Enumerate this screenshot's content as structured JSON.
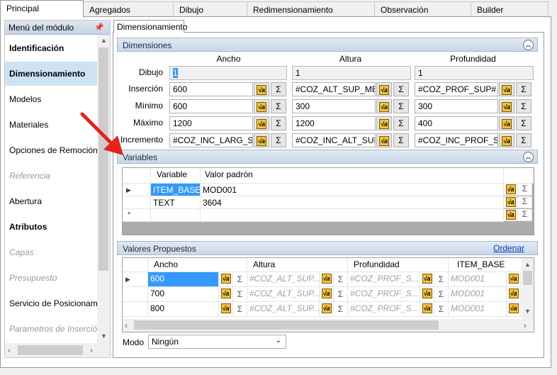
{
  "top_tabs": [
    "Principal",
    "Agregados",
    "Dibujo",
    "Redimensionamiento",
    "Observación",
    "Builder"
  ],
  "sidebar": {
    "title": "Menú del módulo",
    "pin_icon": "pin-icon",
    "items": [
      {
        "label": "Identificación",
        "style": "bold"
      },
      {
        "label": "Dimensionamiento",
        "style": "bold-selected"
      },
      {
        "label": "Modelos",
        "style": "normal"
      },
      {
        "label": "Materiales",
        "style": "normal"
      },
      {
        "label": "Opciones de Remoción",
        "style": "normal"
      },
      {
        "label": "Referencia",
        "style": "disabled"
      },
      {
        "label": "Abertura",
        "style": "normal"
      },
      {
        "label": "Atributos",
        "style": "bold"
      },
      {
        "label": "Capas",
        "style": "disabled"
      },
      {
        "label": "Presupuesto",
        "style": "disabled"
      },
      {
        "label": "Servicio de Posicionamiento",
        "style": "normal"
      },
      {
        "label": "Parametros de Inserción",
        "style": "disabled"
      }
    ]
  },
  "subtab": "Dimensionamiento",
  "dimensiones": {
    "title": "Dimensiones",
    "columns": [
      "Ancho",
      "Altura",
      "Profundidad"
    ],
    "rows": [
      {
        "label": "Dibujo",
        "values": [
          "1",
          "1",
          "1"
        ]
      },
      {
        "label": "Inserción",
        "values": [
          "600",
          "#COZ_ALT_SUP_ME",
          "#COZ_PROF_SUP#"
        ]
      },
      {
        "label": "Mínimo",
        "values": [
          "600",
          "300",
          "300"
        ]
      },
      {
        "label": "Máximo",
        "values": [
          "1200",
          "1200",
          "400"
        ]
      },
      {
        "label": "Incremento",
        "values": [
          "#COZ_INC_LARG_S",
          "#COZ_INC_ALT_SUI",
          "#COZ_INC_PROF_S"
        ]
      }
    ]
  },
  "variables": {
    "title": "Variables",
    "headers": [
      "Variable",
      "Valor padrón"
    ],
    "rows": [
      {
        "variable": "ITEM_BASE",
        "value": "MOD001"
      },
      {
        "variable": "TEXT",
        "value": "3604"
      }
    ]
  },
  "valores": {
    "title": "Valores Propuestos",
    "link": "Ordenar",
    "headers": [
      "Ancho",
      "Altura",
      "Profundidad",
      "ITEM_BASE"
    ],
    "rows": [
      {
        "ancho": "600",
        "altura": "#COZ_ALT_SUP...",
        "prof": "#COZ_PROF_S...",
        "item": "MOD001"
      },
      {
        "ancho": "700",
        "altura": "#COZ_ALT_SUP...",
        "prof": "#COZ_PROF_S...",
        "item": "MOD001"
      },
      {
        "ancho": "800",
        "altura": "#COZ_ALT_SUP...",
        "prof": "#COZ_PROF_S...",
        "item": "MOD001"
      }
    ]
  },
  "modo": {
    "label": "Modo",
    "value": "Ningún"
  },
  "colors": {
    "accent": "#3399ff",
    "selected_item": "#cde3f1",
    "arrow": "#e8211b"
  }
}
